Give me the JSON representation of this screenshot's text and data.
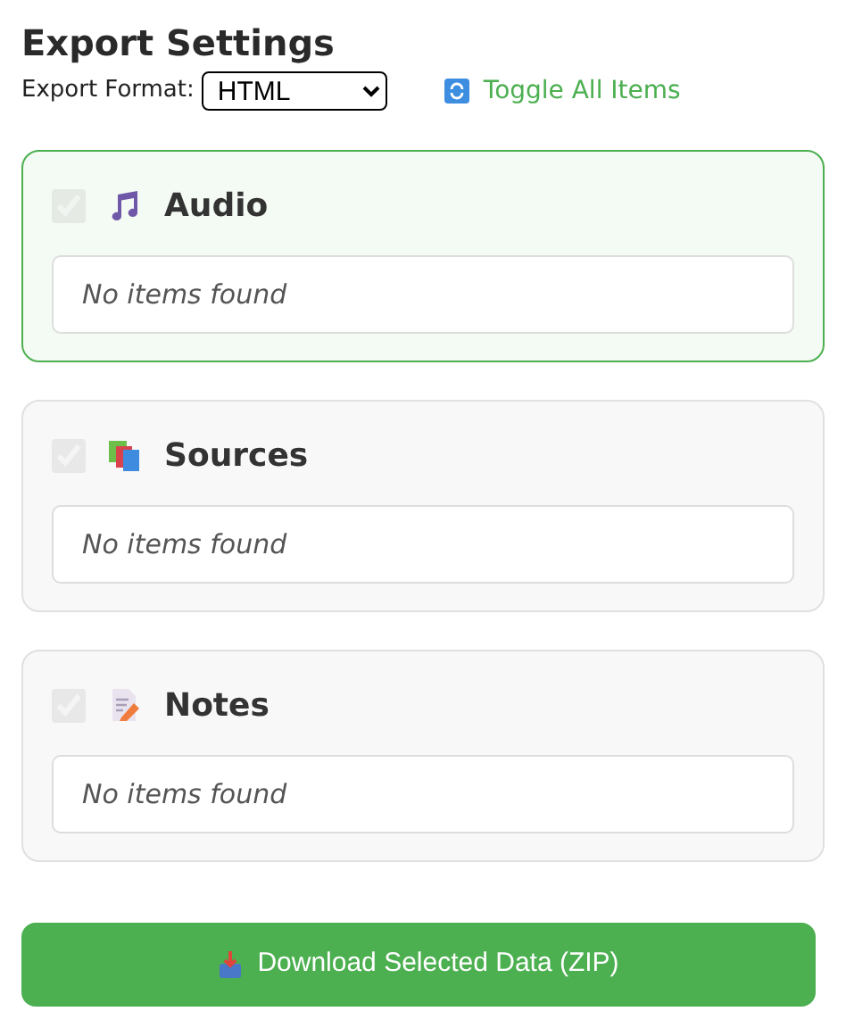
{
  "title": "Export Settings",
  "format": {
    "label": "Export Format:",
    "value": "HTML"
  },
  "toggle_all": {
    "label": "Toggle All Items"
  },
  "sections": [
    {
      "kind": "audio",
      "title": "Audio",
      "checked": true,
      "disabled": true,
      "highlighted": true,
      "empty_text": "No items found"
    },
    {
      "kind": "sources",
      "title": "Sources",
      "checked": true,
      "disabled": true,
      "highlighted": false,
      "empty_text": "No items found"
    },
    {
      "kind": "notes",
      "title": "Notes",
      "checked": true,
      "disabled": true,
      "highlighted": false,
      "empty_text": "No items found"
    }
  ],
  "download_button": {
    "label": "Download Selected Data (ZIP)"
  }
}
